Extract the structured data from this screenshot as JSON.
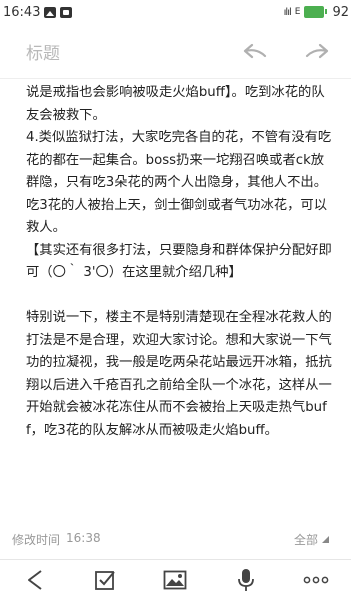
{
  "status_bar": {
    "time": "16:43",
    "signal": "ılıl",
    "network": "E",
    "battery": "92"
  },
  "toolbar": {
    "title_placeholder": "标题"
  },
  "note": {
    "paragraphs": [
      "说是戒指也会影响被吸走火焰buff】。吃到冰花的队友会被救下。",
      "4.类似监狱打法，大家吃完各自的花，不管有没有吃花的都在一起集合。boss扔来一坨翔召唤或者ck放群隐，只有吃3朵花的两个人出隐身，其他人不出。吃3花的人被抬上天，剑士御剑或者气功冰花，可以救人。",
      "【其实还有很多打法，只要隐身和群体保护分配好即可（〇｀ 3'〇）在这里就介绍几种】",
      "",
      "特别说一下，楼主不是特别清楚现在全程冰花救人的打法是不是合理，欢迎大家讨论。想和大家说一下气功的拉凝视，我一般是吃两朵花站最远开冰箱，抵抗翔以后进入千疮百孔之前给全队一个冰花，这样从一开始就会被冰花冻住从而不会被抬上天吸走热气buff，吃3花的队友解冰从而被吸走火焰buff。"
    ]
  },
  "meta": {
    "modified_label": "修改时间",
    "modified_time": "16:38",
    "all_label": "全部"
  },
  "icons": {
    "undo": "undo-icon",
    "redo": "redo-icon",
    "back": "back-icon",
    "checkbox": "checkbox-icon",
    "image": "image-icon",
    "microphone": "microphone-icon",
    "more": "more-icon"
  }
}
